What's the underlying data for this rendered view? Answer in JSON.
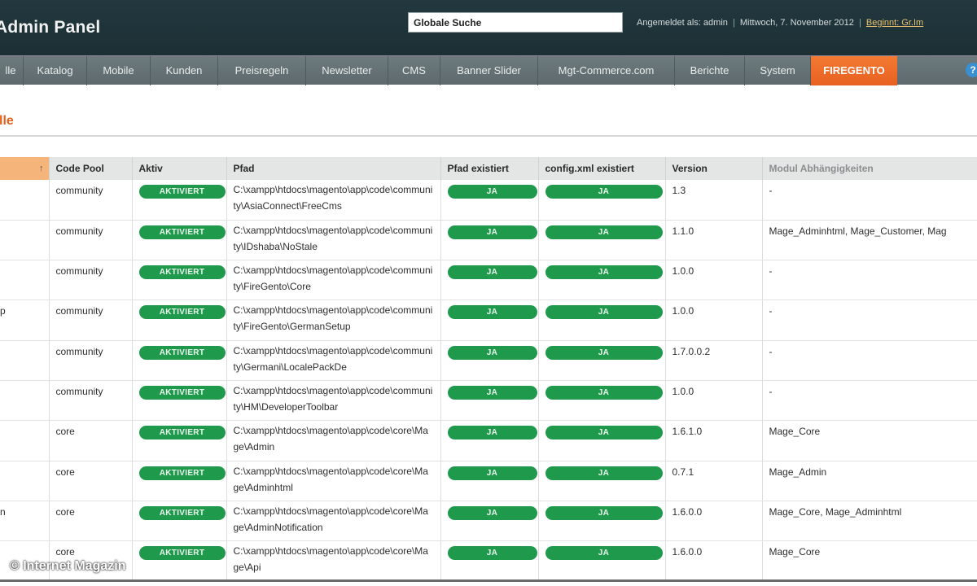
{
  "header": {
    "title": "Admin Panel",
    "search_value": "Globale Suche",
    "logged_in": "Angemeldet als: admin",
    "date": "Mittwoch, 7. November 2012",
    "link": "Beginnt: Gr.Im"
  },
  "nav": {
    "items": [
      {
        "label": "lle"
      },
      {
        "label": "Katalog"
      },
      {
        "label": "Mobile"
      },
      {
        "label": "Kunden"
      },
      {
        "label": "Preisregeln"
      },
      {
        "label": "Newsletter"
      },
      {
        "label": "CMS"
      },
      {
        "label": "Banner Slider"
      },
      {
        "label": "Mgt-Commerce.com"
      },
      {
        "label": "Berichte"
      },
      {
        "label": "System"
      },
      {
        "label": "FIREGENTO"
      }
    ],
    "help": "?"
  },
  "page": {
    "title": "lle"
  },
  "table": {
    "sort_indicator": "↑",
    "headers": {
      "name": "",
      "code_pool": "Code Pool",
      "active": "Aktiv",
      "path": "Pfad",
      "path_exists": "Pfad existiert",
      "config_exists": "config.xml existiert",
      "version": "Version",
      "dependencies": "Modul Abhängigkeiten"
    },
    "rows": [
      {
        "name": "",
        "code_pool": "community",
        "active": "AKTIVIERT",
        "path": "C:\\xampp\\htdocs\\magento\\app\\code\\community\\AsiaConnect\\FreeCms",
        "path_exists": "JA",
        "config_exists": "JA",
        "version": "1.3",
        "deps": "-"
      },
      {
        "name": "",
        "code_pool": "community",
        "active": "AKTIVIERT",
        "path": "C:\\xampp\\htdocs\\magento\\app\\code\\community\\IDshaba\\NoStale",
        "path_exists": "JA",
        "config_exists": "JA",
        "version": "1.1.0",
        "deps": "Mage_Adminhtml, Mage_Customer, Mag"
      },
      {
        "name": "",
        "code_pool": "community",
        "active": "AKTIVIERT",
        "path": "C:\\xampp\\htdocs\\magento\\app\\code\\community\\FireGento\\Core",
        "path_exists": "JA",
        "config_exists": "JA",
        "version": "1.0.0",
        "deps": "-"
      },
      {
        "name": "p",
        "code_pool": "community",
        "active": "AKTIVIERT",
        "path": "C:\\xampp\\htdocs\\magento\\app\\code\\community\\FireGento\\GermanSetup",
        "path_exists": "JA",
        "config_exists": "JA",
        "version": "1.0.0",
        "deps": "-"
      },
      {
        "name": "",
        "code_pool": "community",
        "active": "AKTIVIERT",
        "path": "C:\\xampp\\htdocs\\magento\\app\\code\\community\\Germani\\LocalePackDe",
        "path_exists": "JA",
        "config_exists": "JA",
        "version": "1.7.0.0.2",
        "deps": "-"
      },
      {
        "name": "",
        "code_pool": "community",
        "active": "AKTIVIERT",
        "path": "C:\\xampp\\htdocs\\magento\\app\\code\\community\\HM\\DeveloperToolbar",
        "path_exists": "JA",
        "config_exists": "JA",
        "version": "1.0.0",
        "deps": "-"
      },
      {
        "name": "",
        "code_pool": "core",
        "active": "AKTIVIERT",
        "path": "C:\\xampp\\htdocs\\magento\\app\\code\\core\\Mage\\Admin",
        "path_exists": "JA",
        "config_exists": "JA",
        "version": "1.6.1.0",
        "deps": "Mage_Core"
      },
      {
        "name": "",
        "code_pool": "core",
        "active": "AKTIVIERT",
        "path": "C:\\xampp\\htdocs\\magento\\app\\code\\core\\Mage\\Adminhtml",
        "path_exists": "JA",
        "config_exists": "JA",
        "version": "0.7.1",
        "deps": "Mage_Admin"
      },
      {
        "name": "n",
        "code_pool": "core",
        "active": "AKTIVIERT",
        "path": "C:\\xampp\\htdocs\\magento\\app\\code\\core\\Mage\\AdminNotification",
        "path_exists": "JA",
        "config_exists": "JA",
        "version": "1.6.0.0",
        "deps": "Mage_Core, Mage_Adminhtml"
      },
      {
        "name": "",
        "code_pool": "core",
        "active": "AKTIVIERT",
        "path": "C:\\xampp\\htdocs\\magento\\app\\code\\core\\Mage\\Api",
        "path_exists": "JA",
        "config_exists": "JA",
        "version": "1.6.0.0",
        "deps": "Mage_Core"
      }
    ]
  },
  "watermark": "© Internet Magazin"
}
